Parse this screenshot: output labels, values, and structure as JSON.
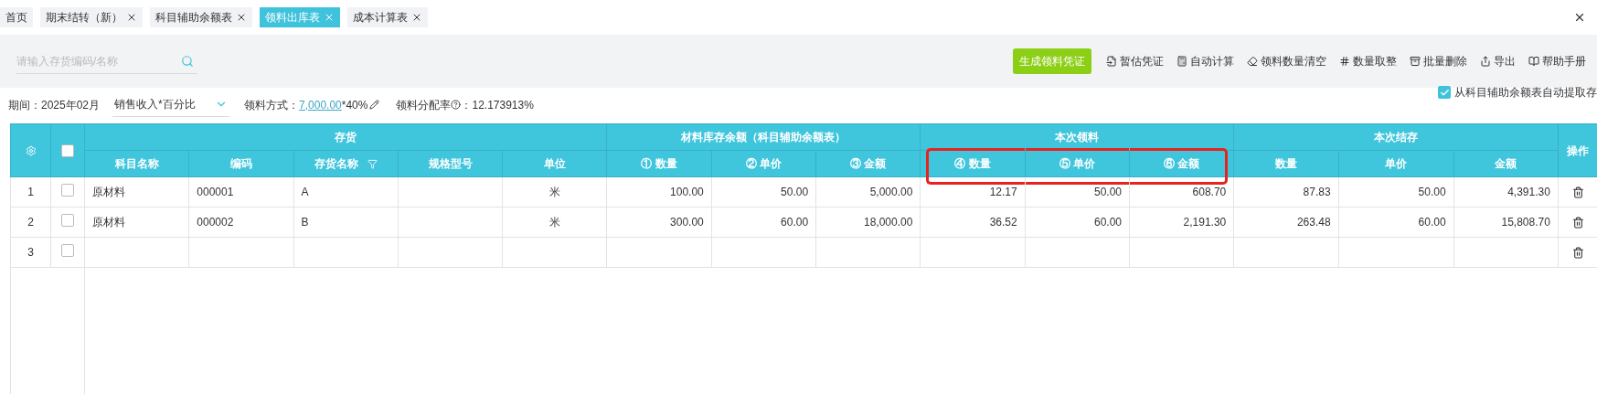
{
  "tabs": [
    {
      "label": "首页",
      "closable": false,
      "selected": false
    },
    {
      "label": "期末结转（新）",
      "closable": true,
      "selected": false
    },
    {
      "label": "科目辅助余额表",
      "closable": true,
      "selected": false
    },
    {
      "label": "领料出库表",
      "closable": true,
      "selected": true
    },
    {
      "label": "成本计算表",
      "closable": true,
      "selected": false
    }
  ],
  "search": {
    "placeholder": "请输入存货编码/名称"
  },
  "toolbar": [
    {
      "label": "生成领料凭证",
      "kind": "primary"
    },
    {
      "label": "暂估凭证",
      "kind": "link"
    },
    {
      "label": "自动计算",
      "kind": "link"
    },
    {
      "label": "领料数量清空",
      "kind": "link"
    },
    {
      "label": "数量取整",
      "kind": "link"
    },
    {
      "label": "批量删除",
      "kind": "link"
    },
    {
      "label": "导出",
      "kind": "link"
    },
    {
      "label": "帮助手册",
      "kind": "link"
    }
  ],
  "filters": {
    "period_label": "期间：",
    "period": "2025年02月",
    "method_select": "销售收入*百分比",
    "method_label": "领料方式：",
    "method_amount": "7,000.00",
    "method_rate": "*40%",
    "rate_label": "领料分配率",
    "rate_value": "：12.173913%"
  },
  "auto_extract": {
    "label": "从科目辅助余额表自动提取存",
    "checked": true
  },
  "table": {
    "action_header": "操作",
    "select_all_checked": false,
    "groups": [
      {
        "label": "存货",
        "highlighted": false,
        "columns": [
          {
            "label": "科目名称",
            "filter": false
          },
          {
            "label": "编码",
            "filter": false
          },
          {
            "label": "存货名称",
            "filter": true
          },
          {
            "label": "规格型号",
            "filter": false
          },
          {
            "label": "单位",
            "filter": false
          }
        ]
      },
      {
        "label": "材料库存余额（科目辅助余额表）",
        "highlighted": false,
        "columns": [
          {
            "label": "① 数量",
            "filter": false
          },
          {
            "label": "② 单价",
            "filter": false
          },
          {
            "label": "③ 金额",
            "filter": false
          }
        ]
      },
      {
        "label": "本次领料",
        "highlighted": true,
        "columns": [
          {
            "label": "④ 数量",
            "filter": false
          },
          {
            "label": "⑤ 单价",
            "filter": false
          },
          {
            "label": "⑥ 金额",
            "filter": false
          }
        ]
      },
      {
        "label": "本次结存",
        "highlighted": false,
        "columns": [
          {
            "label": "数量",
            "filter": false
          },
          {
            "label": "单价",
            "filter": false
          },
          {
            "label": "金额",
            "filter": false
          }
        ]
      }
    ],
    "rows": [
      {
        "index": "1",
        "checked": false,
        "cells": [
          "原材料",
          "000001",
          "A",
          null,
          "米",
          "100.00",
          "50.00",
          "5,000.00",
          "12.17",
          "50.00",
          "608.70",
          "87.83",
          "50.00",
          "4,391.30"
        ]
      },
      {
        "index": "2",
        "checked": false,
        "cells": [
          "原材料",
          "000002",
          "B",
          null,
          "米",
          "300.00",
          "60.00",
          "18,000.00",
          "36.52",
          "60.00",
          "2,191.30",
          "263.48",
          "60.00",
          "15,808.70"
        ]
      },
      {
        "index": "3",
        "checked": false,
        "cells": []
      }
    ]
  }
}
